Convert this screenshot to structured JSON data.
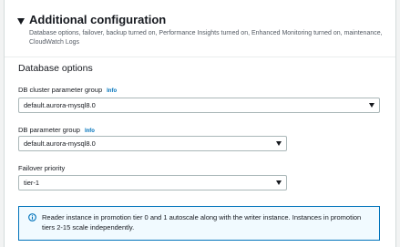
{
  "section": {
    "title": "Additional configuration",
    "description": "Database options, failover, backup turned on, Performance Insights turned on, Enhanced Monitoring turned on, maintenance, CloudWatch Logs"
  },
  "database_options": {
    "title": "Database options",
    "cluster_param_group": {
      "label": "DB cluster parameter group",
      "info": "Info",
      "value": "default.aurora-mysql8.0"
    },
    "param_group": {
      "label": "DB parameter group",
      "info": "Info",
      "value": "default.aurora-mysql8.0"
    },
    "failover_priority": {
      "label": "Failover priority",
      "value": "tier-1"
    },
    "alert": {
      "text": "Reader instance in promotion tier 0 and 1 autoscale along with the writer instance. Instances in promotion tiers 2-15 scale independently."
    }
  },
  "colors": {
    "link": "#0073bb",
    "alert_border": "#0073bb",
    "alert_background": "#f1faff",
    "text": "#16191f",
    "muted_text": "#545b64"
  },
  "icons": {
    "section_toggle": "caret-down-icon",
    "select_arrow": "chevron-down-icon",
    "alert": "info-circle-icon"
  }
}
